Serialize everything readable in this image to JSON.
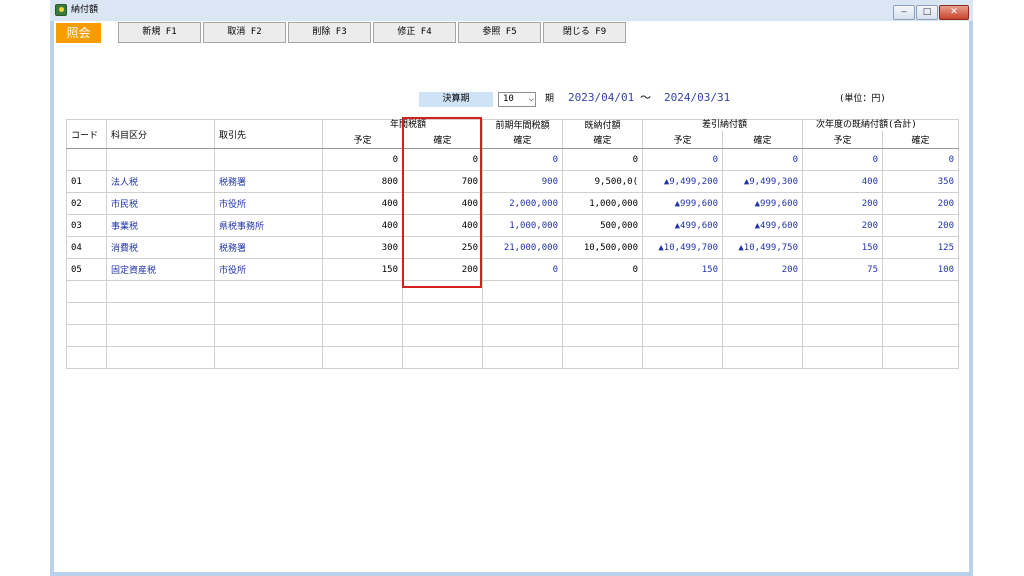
{
  "window": {
    "title": "納付額"
  },
  "toolbar": {
    "mode": "照会",
    "buttons": [
      "新規 F1",
      "取消 F2",
      "削除 F3",
      "修正 F4",
      "参照 F5",
      "閉じる F9"
    ]
  },
  "period": {
    "label": "決算期",
    "value": "10",
    "unit": "期",
    "from": "2023/04/01",
    "tilde": "〜",
    "to": "2024/03/31",
    "unit_note": "(単位：円)"
  },
  "table": {
    "headers": {
      "code": "コード",
      "category": "科目区分",
      "partner": "取引先",
      "annual_tax": "年間税額",
      "prev_annual_tax": "前期年間税額",
      "paid": "既納付額",
      "diff": "差引納付額",
      "next_year_paid": "次年度の既納付額(合計)",
      "planned": "予定",
      "confirmed": "確定"
    },
    "rows": [
      {
        "code": "",
        "category": "",
        "partner": "",
        "annual_planned": "0",
        "annual_confirmed": "0",
        "prev_confirmed": "0",
        "paid_confirmed": "0",
        "diff_planned": "0",
        "diff_confirmed": "0",
        "next_planned": "0",
        "next_confirmed": "0"
      },
      {
        "code": "01",
        "category": "法人税",
        "partner": "税務署",
        "annual_planned": "800",
        "annual_confirmed": "700",
        "prev_confirmed": "900",
        "paid_confirmed": "9,500,0(",
        "diff_planned": "▲9,499,200",
        "diff_confirmed": "▲9,499,300",
        "next_planned": "400",
        "next_confirmed": "350"
      },
      {
        "code": "02",
        "category": "市民税",
        "partner": "市役所",
        "annual_planned": "400",
        "annual_confirmed": "400",
        "prev_confirmed": "2,000,000",
        "paid_confirmed": "1,000,000",
        "diff_planned": "▲999,600",
        "diff_confirmed": "▲999,600",
        "next_planned": "200",
        "next_confirmed": "200"
      },
      {
        "code": "03",
        "category": "事業税",
        "partner": "県税事務所",
        "annual_planned": "400",
        "annual_confirmed": "400",
        "prev_confirmed": "1,000,000",
        "paid_confirmed": "500,000",
        "diff_planned": "▲499,600",
        "diff_confirmed": "▲499,600",
        "next_planned": "200",
        "next_confirmed": "200"
      },
      {
        "code": "04",
        "category": "消費税",
        "partner": "税務署",
        "annual_planned": "300",
        "annual_confirmed": "250",
        "prev_confirmed": "21,000,000",
        "paid_confirmed": "10,500,000",
        "diff_planned": "▲10,499,700",
        "diff_confirmed": "▲10,499,750",
        "next_planned": "150",
        "next_confirmed": "125"
      },
      {
        "code": "05",
        "category": "固定資産税",
        "partner": "市役所",
        "annual_planned": "150",
        "annual_confirmed": "200",
        "prev_confirmed": "0",
        "paid_confirmed": "0",
        "diff_planned": "150",
        "diff_confirmed": "200",
        "next_planned": "75",
        "next_confirmed": "100"
      }
    ],
    "empty_rows": 4
  },
  "colors": {
    "accent": "#f59c00",
    "value_blue": "#2233aa",
    "highlight": "#d42020",
    "period_label_bg": "#cfe3f7"
  }
}
